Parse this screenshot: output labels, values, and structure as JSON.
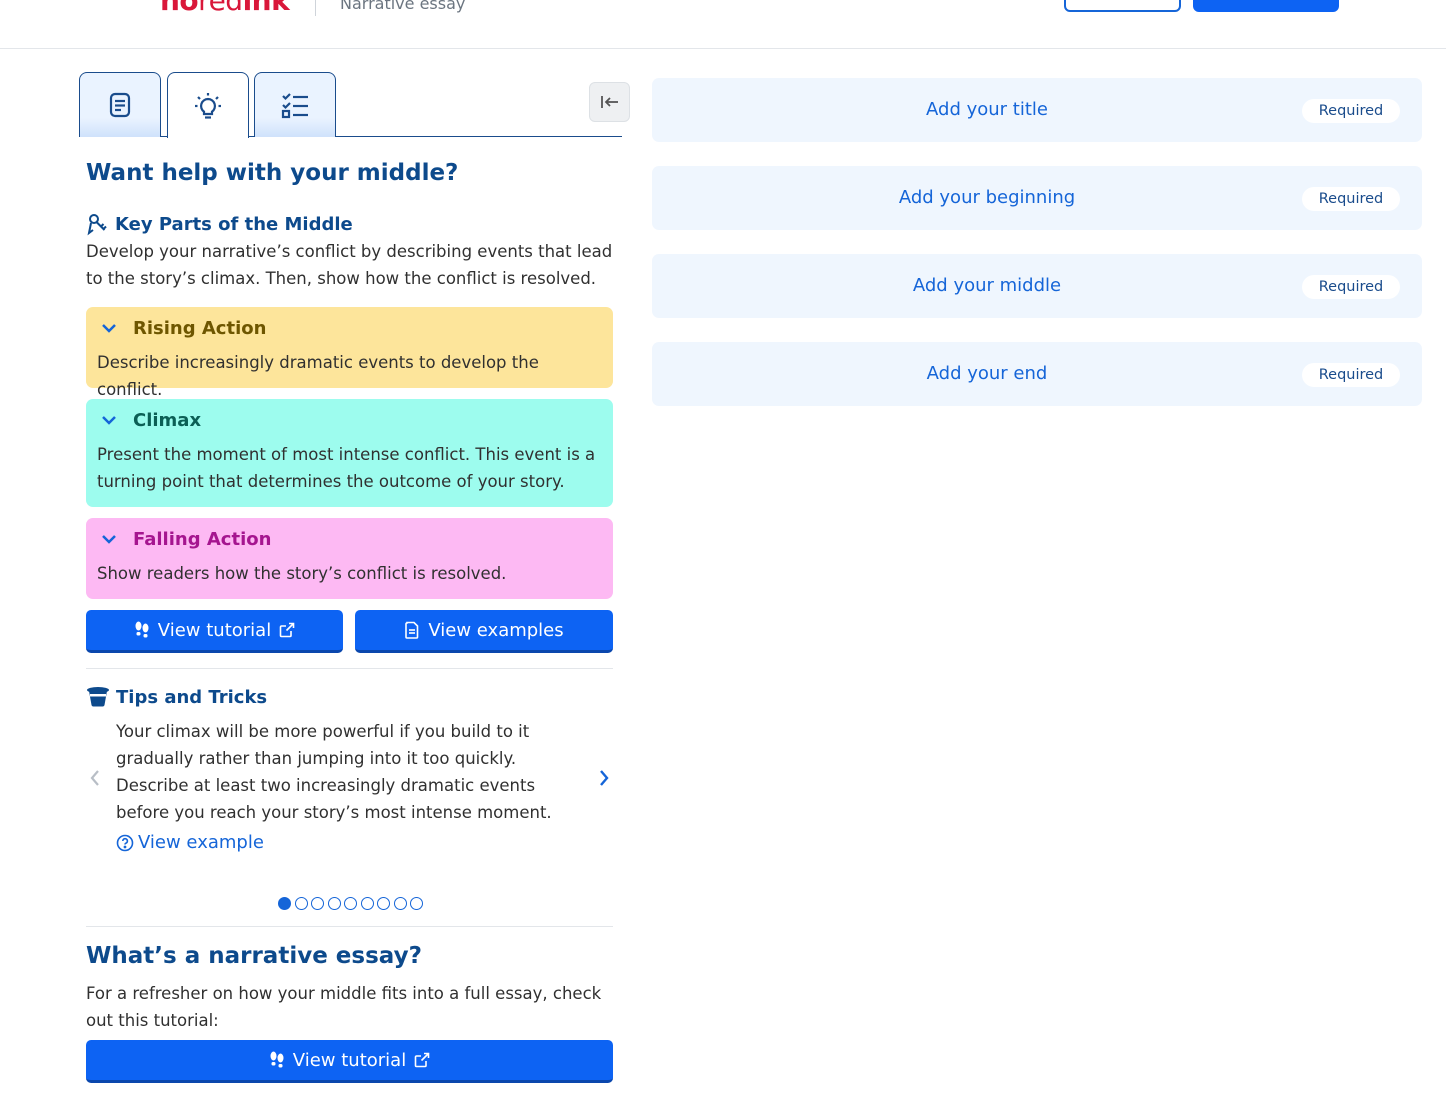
{
  "header": {
    "logo_bold": "no",
    "logo_thin": "red",
    "logo_end": "ink",
    "doc_type": "Narrative essay"
  },
  "left_panel": {
    "heading": "Want help with your middle?",
    "key_parts": {
      "title": "Key Parts of the Middle",
      "description": "Develop your narrative’s conflict by describing events that lead to the story’s climax. Then, show how the conflict is resolved."
    },
    "cards": [
      {
        "title": "Rising Action",
        "body": "Describe increasingly dramatic events to develop the conflict.",
        "color": "#fde59b"
      },
      {
        "title": "Climax",
        "body": "Present the moment of most intense conflict. This event is a turning point that determines the outcome of your story.",
        "color": "#9dfcee"
      },
      {
        "title": "Falling Action",
        "body": "Show readers how the story’s conflict is resolved.",
        "color": "#fdb9f3"
      }
    ],
    "buttons": {
      "view_tutorial": "View tutorial",
      "view_examples": "View examples"
    },
    "tips": {
      "title": "Tips and Tricks",
      "text": "Your climax will be more powerful if you build to it gradually rather than jumping into it too quickly. Describe at least two increasingly dramatic events before you reach your story’s most intense moment.",
      "link": "View example",
      "current_page": 1,
      "total_pages": 9
    },
    "narrative": {
      "heading": "What’s a narrative essay?",
      "description": "For a refresher on how your middle fits into a full essay, check out this tutorial:",
      "button": "View tutorial"
    }
  },
  "outline": {
    "slots": [
      {
        "label": "Add your title",
        "badge": "Required"
      },
      {
        "label": "Add your beginning",
        "badge": "Required"
      },
      {
        "label": "Add your middle",
        "badge": "Required"
      },
      {
        "label": "Add your end",
        "badge": "Required"
      }
    ]
  },
  "colors": {
    "accent": "#0d63f3",
    "heading": "#0d4a8c",
    "link": "#1565d8"
  }
}
